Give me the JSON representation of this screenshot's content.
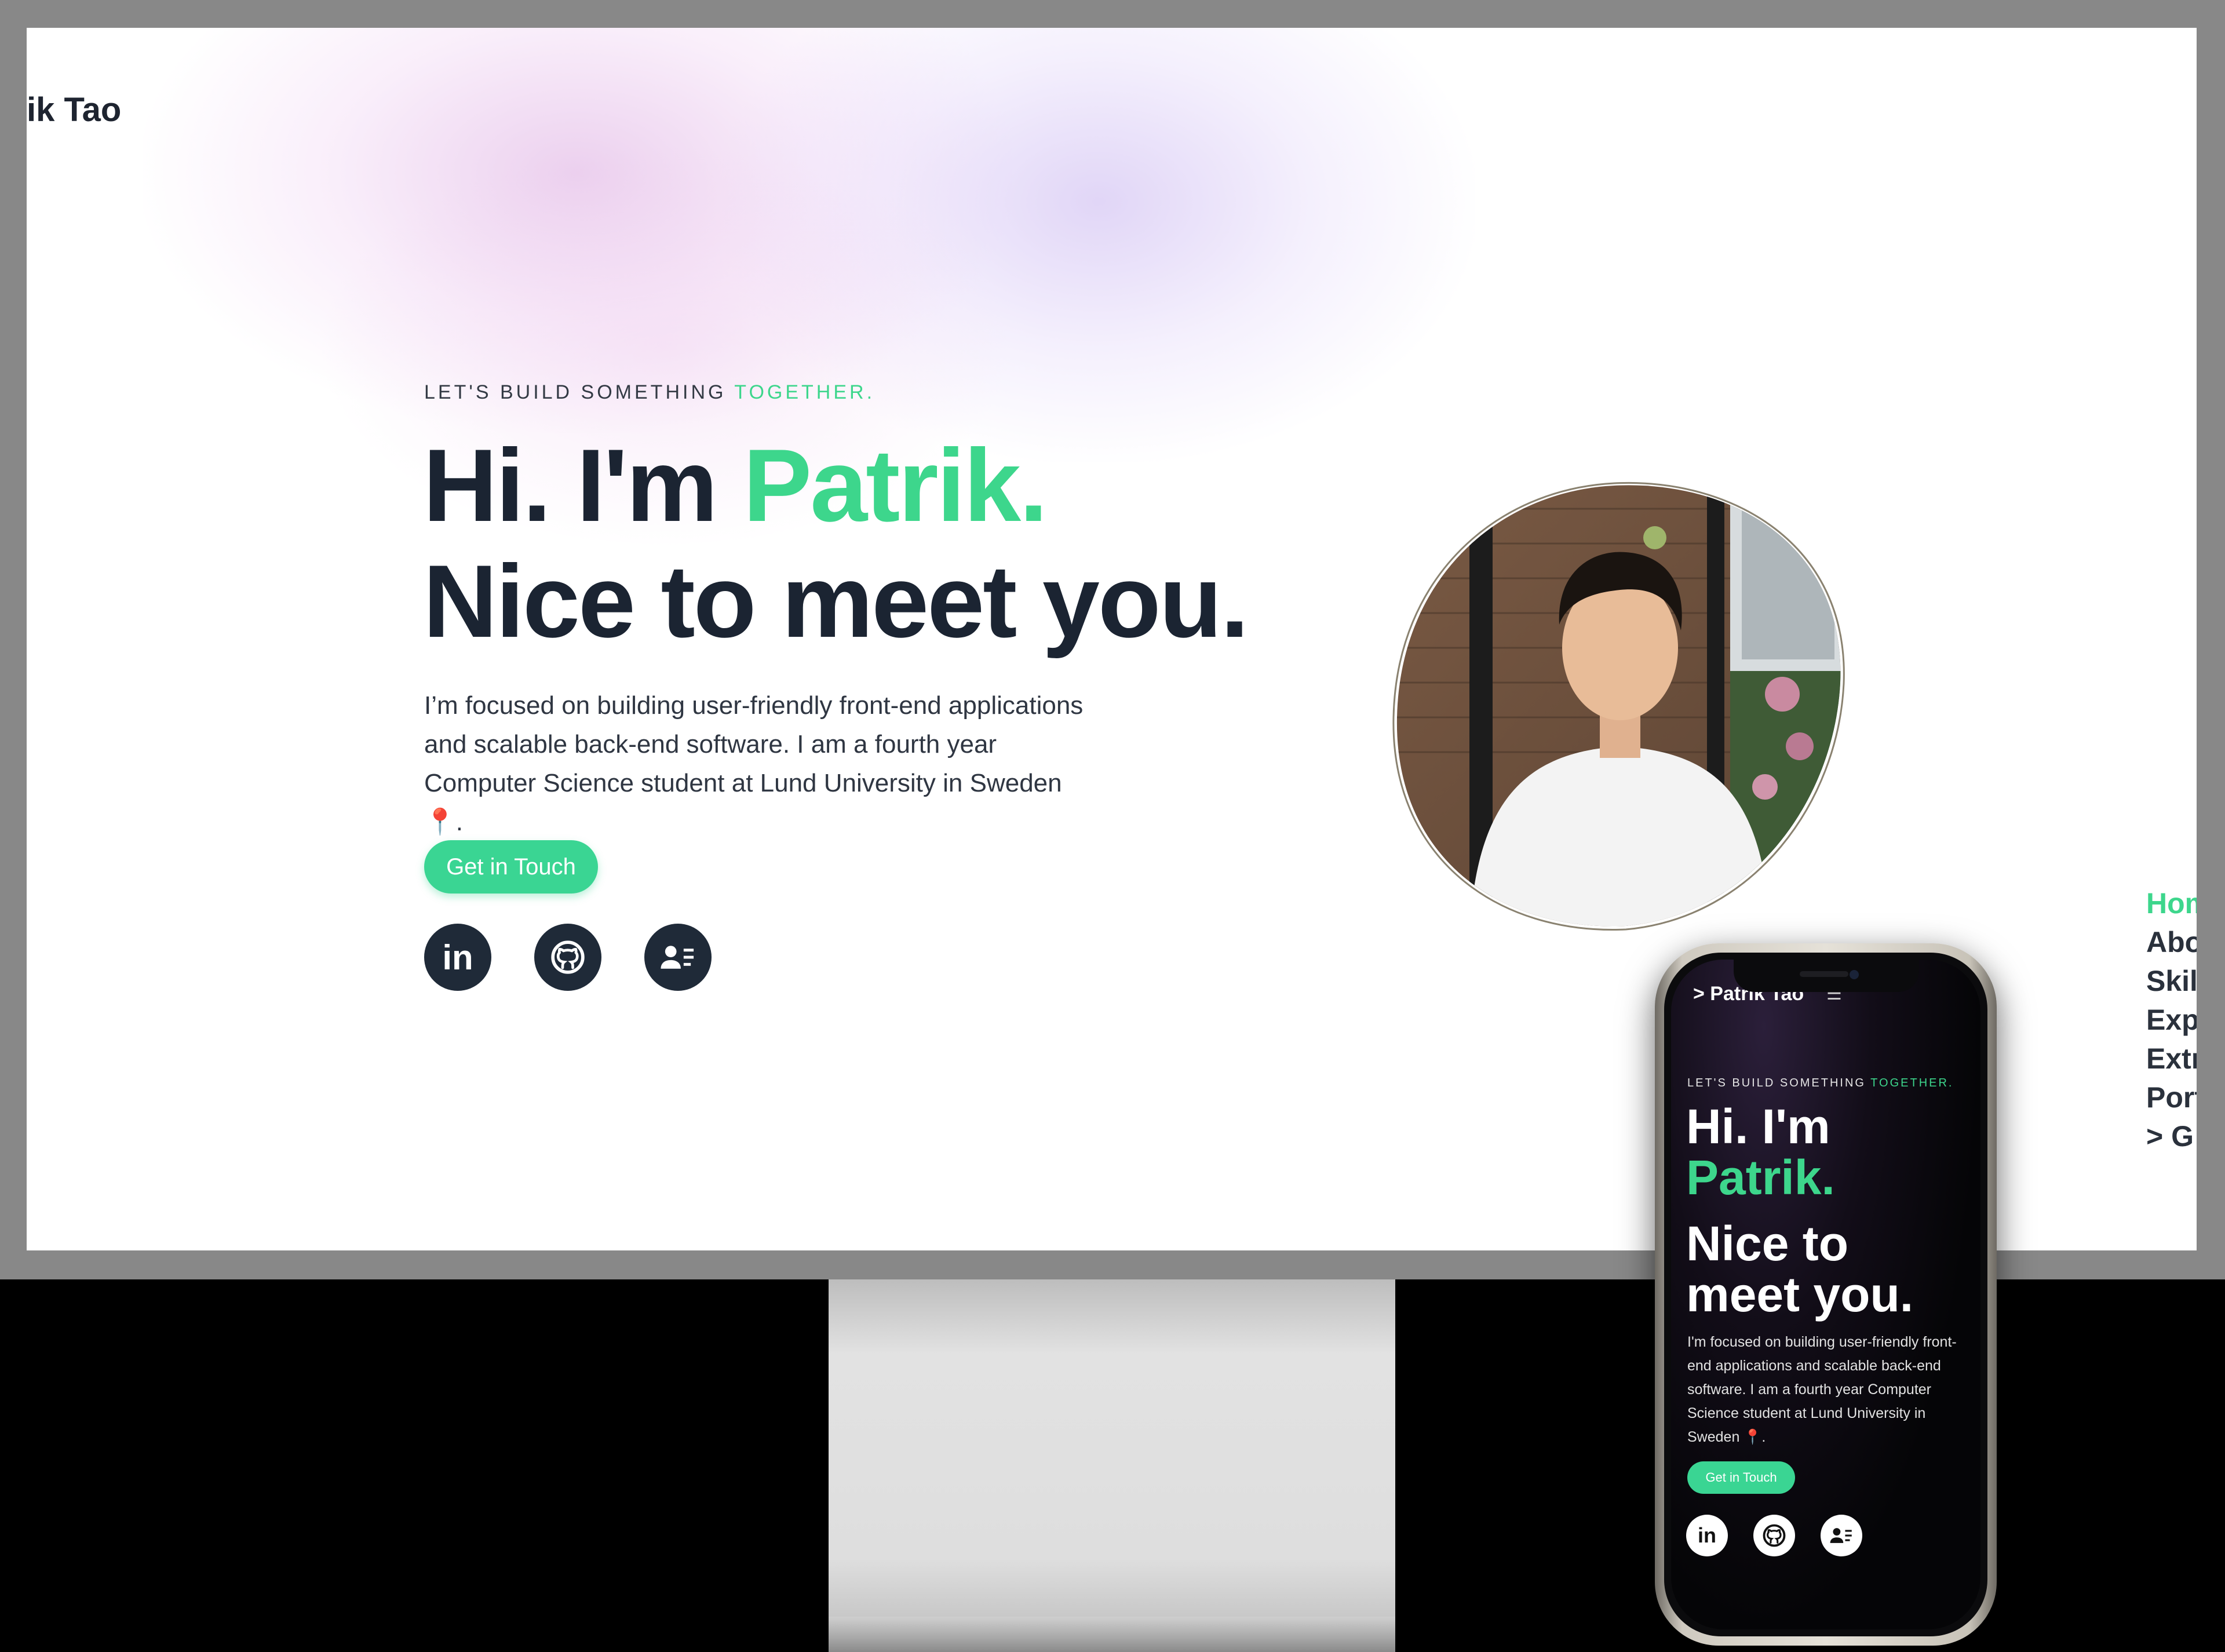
{
  "desktop": {
    "logo": "ik Tao",
    "hero": {
      "eyebrow_main": "LET'S BUILD SOMETHING ",
      "eyebrow_accent": "TOGETHER.",
      "greeting": "Hi. I'm ",
      "name": "Patrik.",
      "line2": "Nice to meet you.",
      "bio_line1": "I’m focused on building user-friendly front-end applications",
      "bio_line2": "and scalable back-end software. I am a fourth year",
      "bio_line3": "Computer Science student at Lund University in Sweden",
      "bio_line4": "📍.",
      "cta": "Get in Touch"
    },
    "social": [
      {
        "label": "in",
        "icon": "linkedin-icon"
      },
      {
        "label": "",
        "icon": "github-icon"
      },
      {
        "label": "",
        "icon": "contact-card-icon"
      }
    ],
    "sidenav": [
      "Hom",
      "Abo",
      "Skil",
      "Exp",
      "Extr",
      "Port",
      "> G"
    ],
    "accent_color": "#3dd68c"
  },
  "mobile": {
    "logo": "> Patrik Tao",
    "menu_icon": "☰",
    "eyebrow_main": "LET'S BUILD SOMETHING ",
    "eyebrow_accent": "TOGETHER.",
    "greeting": "Hi. I'm",
    "name": "Patrik.",
    "line2a": "Nice to",
    "line2b": "meet you.",
    "bio": "I'm focused on building user-friendly front-end applications and scalable back-end software. I am a fourth year Computer Science student at Lund University in Sweden 📍.",
    "cta": "Get in Touch"
  }
}
